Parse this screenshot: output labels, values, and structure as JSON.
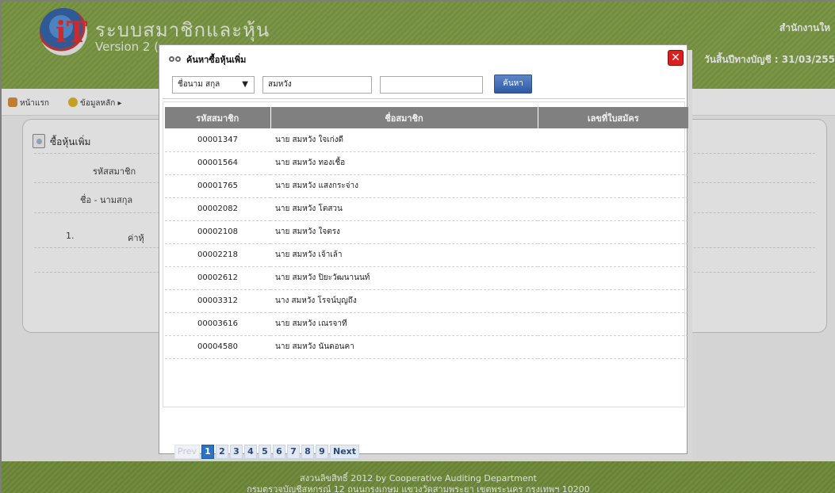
{
  "header": {
    "app_title": "ระบบสมาชิกและหุ้น",
    "version": "Version 2 (",
    "org": "สำนักงานให",
    "fiscal_date": "วันสิ้นปีทางบัญชี : 31/03/255"
  },
  "menu": {
    "home": "หน้าแรก",
    "main_data": "ข้อมูลหลัก ▸"
  },
  "page": {
    "title": "ซื้อหุ้นเพิ่ม",
    "label_member_id": "รหัสสมาชิก",
    "label_name": "ชื่อ - นามสกุล",
    "row_number": "1.",
    "row_label": "ค่าหุ้"
  },
  "footer": {
    "line1": "สงวนลิขสิทธิ์ 2012 by Cooperative Auditing Department",
    "line2": "กรมตรวจบัญชีสหกรณ์ 12 ถนนกรุงเกษม แขวงวัดสามพระยา เขตพระนคร กรุงเทพฯ 10200"
  },
  "modal": {
    "title": "ค้นหาซื้อหุ้นเพิ่ม",
    "close_glyph": "✕",
    "search_field_selected": "ชื่อนาม สกุล",
    "search_value": "สมหวัง",
    "search_value2": "",
    "search_button": "ค้นหา",
    "columns": [
      "รหัสสมาชิก",
      "ชื่อสมาชิก",
      "เลขที่ใบสมัคร"
    ],
    "rows": [
      {
        "id": "00001347",
        "name": "นาย สมหวัง ใจเก่งดี",
        "app_no": ""
      },
      {
        "id": "00001564",
        "name": "นาย สมหวัง ทองเชื้อ",
        "app_no": ""
      },
      {
        "id": "00001765",
        "name": "นาย สมหวัง แสงกระจ่าง",
        "app_no": ""
      },
      {
        "id": "00002082",
        "name": "นาย สมหวัง โตสวน",
        "app_no": ""
      },
      {
        "id": "00002108",
        "name": "นาย สมหวัง ใจตรง",
        "app_no": ""
      },
      {
        "id": "00002218",
        "name": "นาย สมหวัง เจ้าเล้า",
        "app_no": ""
      },
      {
        "id": "00002612",
        "name": "นาย สมหวัง ปิยะวัฒนานนท์",
        "app_no": ""
      },
      {
        "id": "00003312",
        "name": "นาง สมหวัง โรจน์บุญถึง",
        "app_no": ""
      },
      {
        "id": "00003616",
        "name": "นาย สมหวัง เณรจาที",
        "app_no": ""
      },
      {
        "id": "00004580",
        "name": "นาย สมหวัง นันดอนคา",
        "app_no": ""
      }
    ],
    "pager": {
      "prev": "Prev",
      "pages": [
        "1",
        "2",
        "3",
        "4",
        "5",
        "6",
        "7",
        "8",
        "9"
      ],
      "current": "1",
      "next": "Next"
    }
  },
  "colors": {
    "header_green": "#86a646",
    "table_header": "#808080",
    "accent_blue": "#2c73c6",
    "close_red": "#d9201f"
  },
  "icons": [
    "logo",
    "home-icon",
    "star-icon",
    "doc-icon",
    "binoculars-icon",
    "close-icon",
    "caret-down-icon"
  ]
}
